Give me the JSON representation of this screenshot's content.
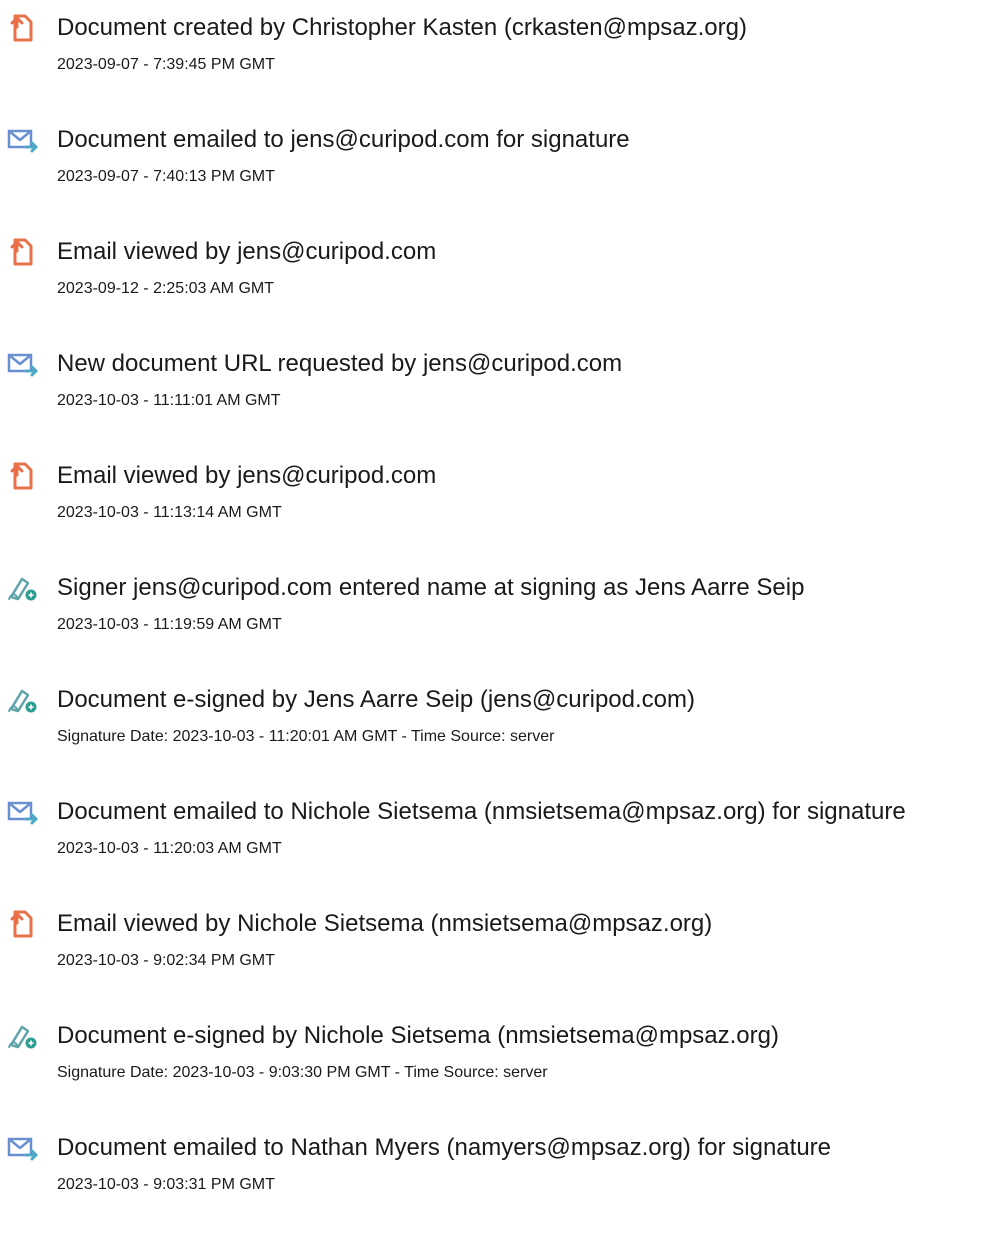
{
  "colors": {
    "document_icon": "#e8714a",
    "email_icon": "#6a8fd0",
    "email_arrow": "#4fa8c4",
    "sign_icon": "#5ea4a8",
    "sign_badge": "#2e9d91"
  },
  "events": [
    {
      "icon": "document-icon",
      "title": "Document created by Christopher Kasten (crkasten@mpsaz.org)",
      "meta": "2023-09-07 - 7:39:45 PM GMT"
    },
    {
      "icon": "email-icon",
      "title": "Document emailed to jens@curipod.com for signature",
      "meta": "2023-09-07 - 7:40:13 PM GMT"
    },
    {
      "icon": "document-icon",
      "title": "Email viewed by jens@curipod.com",
      "meta": "2023-09-12 - 2:25:03 AM GMT"
    },
    {
      "icon": "email-icon",
      "title": "New document URL requested by jens@curipod.com",
      "meta": "2023-10-03 - 11:11:01 AM GMT"
    },
    {
      "icon": "document-icon",
      "title": "Email viewed by jens@curipod.com",
      "meta": "2023-10-03 - 11:13:14 AM GMT"
    },
    {
      "icon": "signature-icon",
      "title": "Signer jens@curipod.com entered name at signing as Jens Aarre Seip",
      "meta": "2023-10-03 - 11:19:59 AM GMT"
    },
    {
      "icon": "signature-icon",
      "title": "Document e-signed by Jens Aarre Seip (jens@curipod.com)",
      "meta": "Signature Date: 2023-10-03 - 11:20:01 AM GMT - Time Source: server"
    },
    {
      "icon": "email-icon",
      "title": "Document emailed to Nichole Sietsema (nmsietsema@mpsaz.org) for signature",
      "meta": "2023-10-03 - 11:20:03 AM GMT"
    },
    {
      "icon": "document-icon",
      "title": "Email viewed by Nichole Sietsema (nmsietsema@mpsaz.org)",
      "meta": "2023-10-03 - 9:02:34 PM GMT"
    },
    {
      "icon": "signature-icon",
      "title": "Document e-signed by Nichole Sietsema (nmsietsema@mpsaz.org)",
      "meta": "Signature Date: 2023-10-03 - 9:03:30 PM GMT - Time Source: server"
    },
    {
      "icon": "email-icon",
      "title": "Document emailed to Nathan Myers (namyers@mpsaz.org) for signature",
      "meta": "2023-10-03 - 9:03:31 PM GMT"
    }
  ]
}
